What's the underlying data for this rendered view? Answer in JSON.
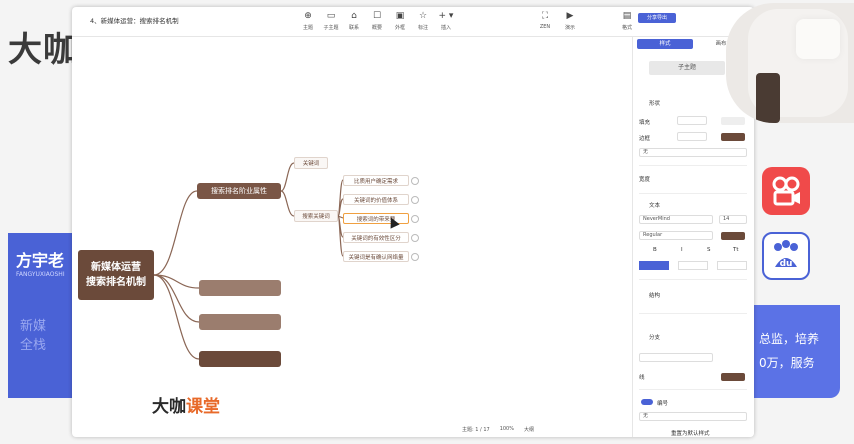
{
  "slide": {
    "brand_big": "大咖",
    "brand_sub": "课堂",
    "card_name": "方宇老",
    "card_en": "FANGYUXIAOSHI",
    "card_role": "新媒全栈",
    "right_text_1": "总监，培养",
    "right_text_2": "0万，服务",
    "bottom_logo_a": "大咖",
    "bottom_logo_b": "课堂",
    "icon_red": "kuaishou-icon",
    "icon_baidu": "du"
  },
  "editor": {
    "doc_title": "4、新媒体运营：搜索排名机制",
    "toolbar": [
      {
        "icon": "主题",
        "label": "主题"
      },
      {
        "icon": "▭",
        "label": "子主题"
      },
      {
        "icon": "⌂",
        "label": "联系"
      },
      {
        "icon": "☐",
        "label": "概要"
      },
      {
        "icon": "▣",
        "label": "外框"
      },
      {
        "icon": "☆",
        "label": "标注"
      },
      {
        "icon": "+ ▾",
        "label": "插入"
      }
    ],
    "toolbar_right": [
      {
        "icon": "⛶",
        "label": "ZEN"
      },
      {
        "icon": "▶",
        "label": "演示"
      },
      {
        "icon": "▤",
        "label": "格式"
      }
    ],
    "export_label": "分享导出",
    "status": {
      "topic_count": "主题: 1 / 17",
      "zoom": "100%",
      "mode": "大纲"
    }
  },
  "mindmap": {
    "root_line1": "新媒体运营",
    "root_line2": "搜索排名机制",
    "main1": "搜索排名阶业属性",
    "main2": "",
    "main3": "",
    "main4": "",
    "sub1": "关键词",
    "sub2": "搜索关键词",
    "leaves": [
      "比质用户确定需求",
      "关键词的价值体系",
      "搜索词的带来要",
      "关键词的有效性区分",
      "关键词是有确认网络量"
    ]
  },
  "panel": {
    "tab_style": "样式",
    "tab_map": "画布",
    "sub_topic_button": "子主题",
    "shape_label": "形状",
    "fill_label": "填充",
    "border_label": "边框",
    "none_option": "无",
    "width_label": "宽度",
    "text_label": "文本",
    "font_family": "NeverMind",
    "font_size": "14",
    "font_weight": "Regular",
    "bold": "B",
    "italic": "I",
    "strike": "S",
    "case": "Tt",
    "structure_label": "结构",
    "branch_label": "分支",
    "line_label": "线",
    "numbering_label": "编号",
    "numbering_value": "无",
    "reset": "重置为默认样式",
    "colors": {
      "accent": "#4a62d6",
      "brown": "#7a5646",
      "swatch": "#6b4a3a"
    }
  }
}
